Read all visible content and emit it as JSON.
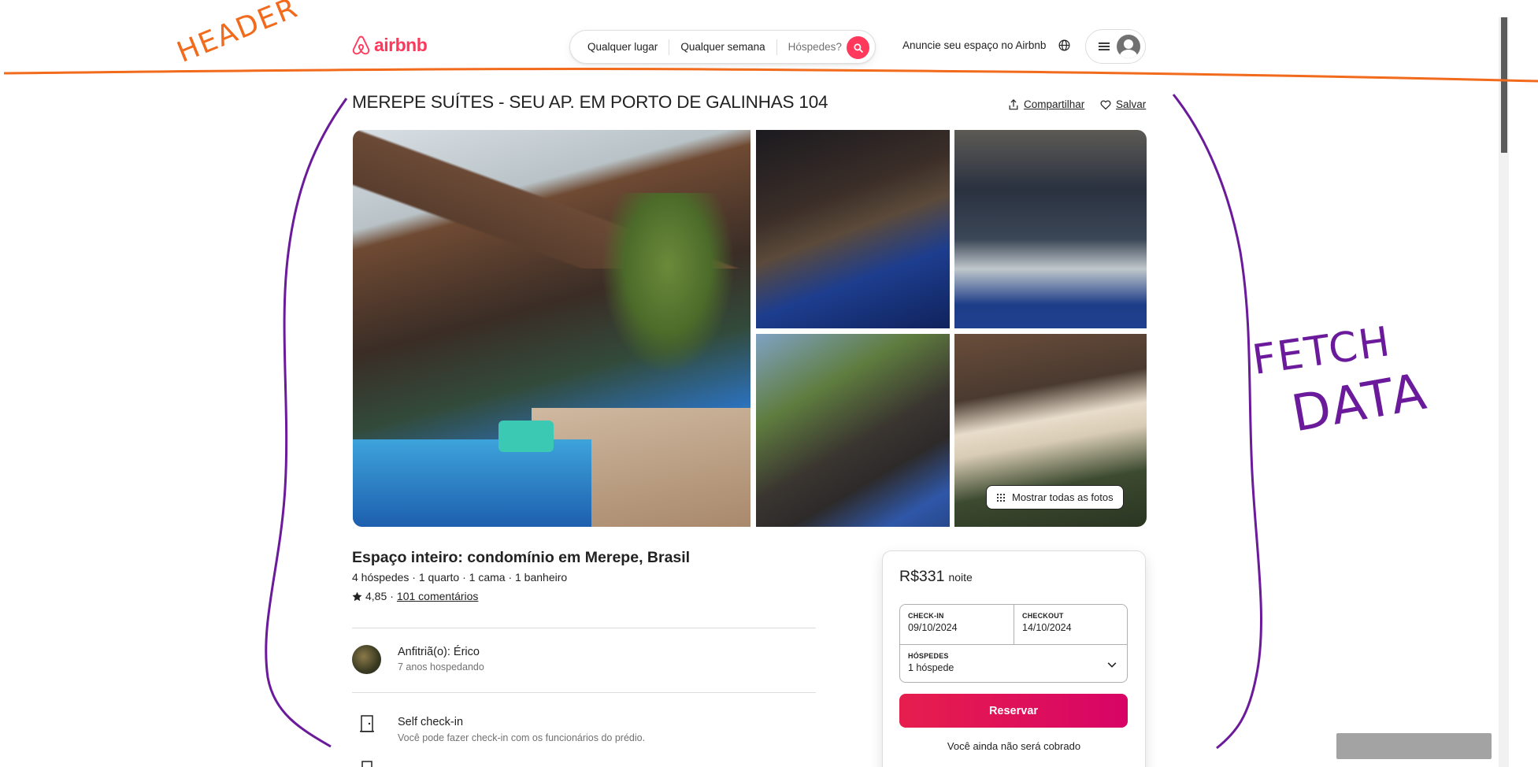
{
  "header": {
    "logo_text": "airbnb",
    "search": {
      "place": "Qualquer lugar",
      "week": "Qualquer semana",
      "guests": "Hóspedes?"
    },
    "host_link": "Anuncie seu espaço no Airbnb"
  },
  "listing": {
    "title": "MEREPE SUÍTES - SEU AP. EM PORTO DE GALINHAS 104",
    "share_label": "Compartilhar",
    "save_label": "Salvar",
    "show_all_photos": "Mostrar todas as fotos",
    "type": "Espaço inteiro: condomínio em Merepe, Brasil",
    "meta": "4 hóspedes · 1 quarto · 1 cama · 1 banheiro",
    "rating": "4,85",
    "rating_sep": "·",
    "reviews": "101 comentários"
  },
  "host": {
    "name": "Anfitriã(o): Érico",
    "years": "7 anos hospedando"
  },
  "features": [
    {
      "title": "Self check-in",
      "desc": "Você pode fazer check-in com os funcionários do prédio."
    }
  ],
  "booking": {
    "price": "R$331",
    "per_night": "noite",
    "checkin_label": "CHECK-IN",
    "checkin_value": "09/10/2024",
    "checkout_label": "CHECKOUT",
    "checkout_value": "14/10/2024",
    "guests_label": "HÓSPEDES",
    "guests_value": "1 hóspede",
    "reserve_label": "Reservar",
    "no_charge": "Você ainda não será cobrado"
  },
  "annotations": {
    "header": "HEADER",
    "fetch": "FETCH",
    "data": "DATA"
  },
  "colors": {
    "brand": "#ff385c",
    "reserve_start": "#e61e4d",
    "reserve_end": "#d70466",
    "annotation_orange": "#f26a1b",
    "annotation_purple": "#6a1a9b"
  },
  "icons": [
    "airbnb-logo-icon",
    "search-icon",
    "globe-icon",
    "menu-icon",
    "user-avatar-icon",
    "share-icon",
    "heart-icon",
    "grid-icon",
    "star-icon",
    "door-icon",
    "chevron-down-icon"
  ]
}
